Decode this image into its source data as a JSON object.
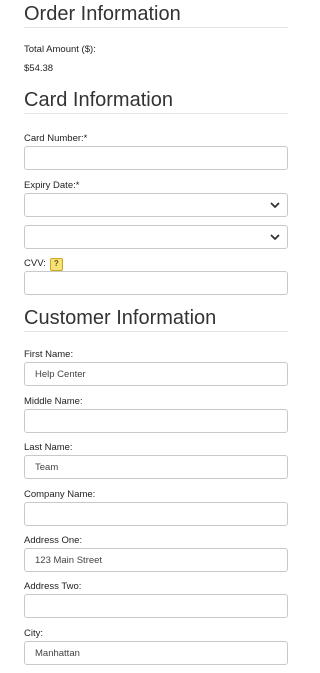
{
  "order": {
    "title": "Order Information",
    "total_label": "Total Amount ($):",
    "total_value": "$54.38"
  },
  "card": {
    "title": "Card Information",
    "number_label": "Card Number:*",
    "number_value": "",
    "expiry_label": "Expiry Date:*",
    "expiry_month_value": "",
    "expiry_year_value": "",
    "cvv_label": "CVV:",
    "cvv_help": "?",
    "cvv_value": ""
  },
  "customer": {
    "title": "Customer Information",
    "fields": [
      {
        "label": "First Name:",
        "value": "Help Center"
      },
      {
        "label": "Middle Name:",
        "value": ""
      },
      {
        "label": "Last Name:",
        "value": "Team"
      },
      {
        "label": "Company Name:",
        "value": ""
      },
      {
        "label": "Address One:",
        "value": "123 Main Street"
      },
      {
        "label": "Address Two:",
        "value": ""
      },
      {
        "label": "City:",
        "value": "Manhattan"
      }
    ]
  },
  "icons": {
    "select_chevron": "chevron-down-icon",
    "cvv_help": "help-icon"
  },
  "colors": {
    "border": "#c9c9c9",
    "rule": "#e3e3e3",
    "help_badge": "#f7e27a"
  }
}
